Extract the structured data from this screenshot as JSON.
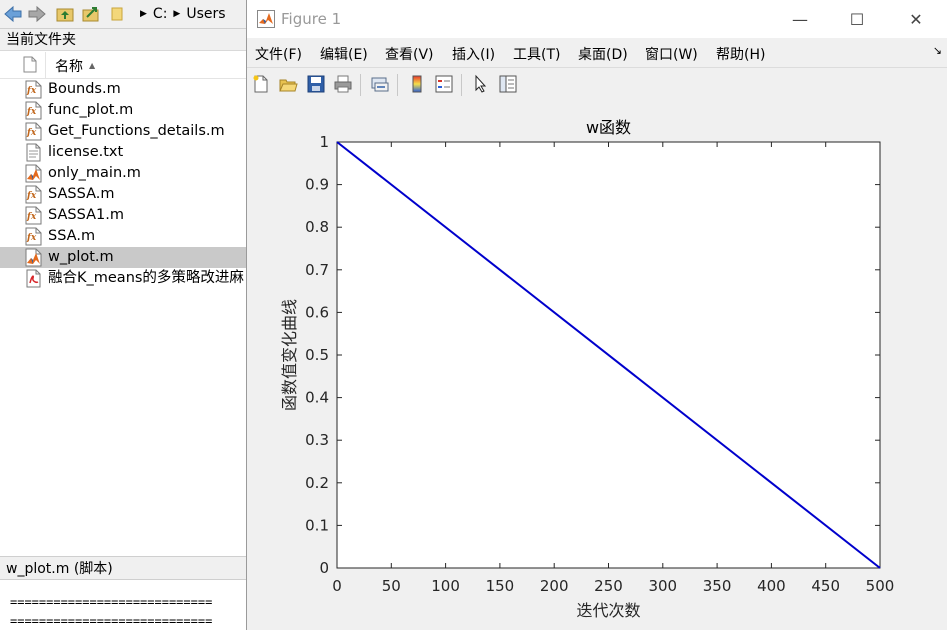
{
  "file_browser": {
    "breadcrumb": [
      "C:",
      "Users"
    ],
    "panel_title": "当前文件夹",
    "column_name": "名称",
    "files": [
      {
        "name": "Bounds.m",
        "type": "function"
      },
      {
        "name": "func_plot.m",
        "type": "function"
      },
      {
        "name": "Get_Functions_details.m",
        "type": "function"
      },
      {
        "name": "license.txt",
        "type": "text"
      },
      {
        "name": "only_main.m",
        "type": "script"
      },
      {
        "name": "SASSA.m",
        "type": "function"
      },
      {
        "name": "SASSA1.m",
        "type": "function"
      },
      {
        "name": "SSA.m",
        "type": "function"
      },
      {
        "name": "w_plot.m",
        "type": "script",
        "selected": true
      },
      {
        "name": "融合K_means的多策略改进麻",
        "type": "pdf"
      }
    ],
    "details_title": "w_plot.m  (脚本)",
    "preview_lines": [
      "============================",
      "============================"
    ]
  },
  "figure_window": {
    "title": "Figure 1",
    "menu": [
      "文件(F)",
      "编辑(E)",
      "查看(V)",
      "插入(I)",
      "工具(T)",
      "桌面(D)",
      "窗口(W)",
      "帮助(H)"
    ],
    "toolbar_icons": [
      "new-figure-icon",
      "open-file-icon",
      "save-icon",
      "print-icon",
      "link-plot-icon",
      "insert-colorbar-icon",
      "insert-legend-icon",
      "edit-plot-arrow-icon",
      "property-inspector-icon"
    ],
    "controls": {
      "minimize": "—",
      "maximize": "☐",
      "close": "✕"
    }
  },
  "chart_data": {
    "type": "line",
    "title": "w函数",
    "xlabel": "迭代次数",
    "ylabel": "函数值变化曲线",
    "xlim": [
      0,
      500
    ],
    "ylim": [
      0,
      1
    ],
    "xticks": [
      0,
      50,
      100,
      150,
      200,
      250,
      300,
      350,
      400,
      450,
      500
    ],
    "yticks": [
      0,
      0.1,
      0.2,
      0.3,
      0.4,
      0.5,
      0.6,
      0.7,
      0.8,
      0.9,
      1
    ],
    "grid": false,
    "series": [
      {
        "x": [
          0,
          500
        ],
        "y": [
          1,
          0
        ],
        "color": "#0000cc"
      }
    ]
  }
}
